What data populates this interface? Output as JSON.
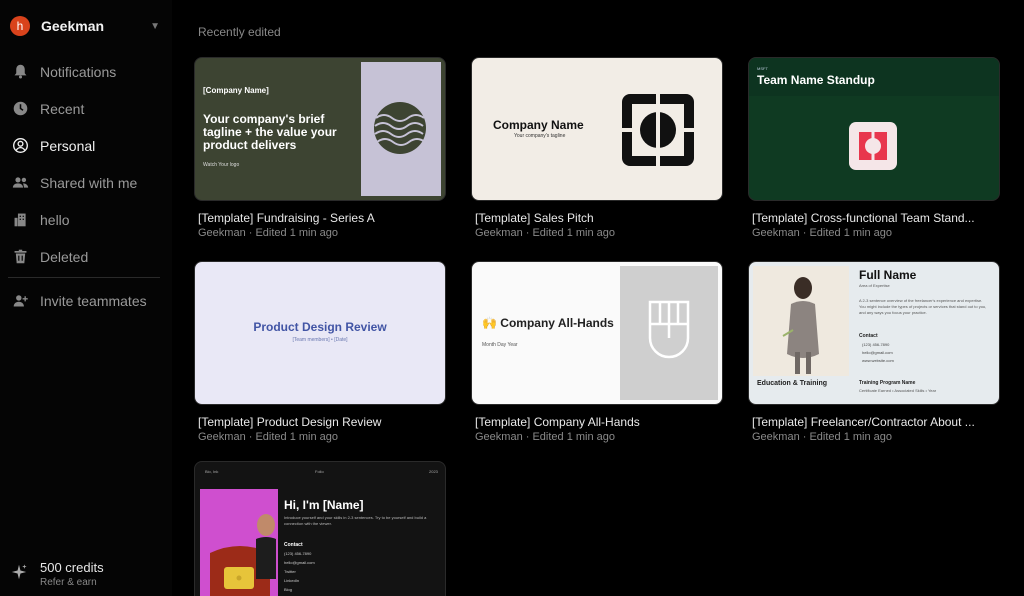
{
  "sidebar": {
    "account": {
      "initial": "h",
      "name": "Geekman"
    },
    "items": [
      {
        "label": "Notifications",
        "icon": "bell-icon"
      },
      {
        "label": "Recent",
        "icon": "clock-icon"
      },
      {
        "label": "Personal",
        "icon": "user-circle-icon",
        "active": true
      },
      {
        "label": "Shared with me",
        "icon": "users-icon"
      },
      {
        "label": "hello",
        "icon": "building-icon"
      },
      {
        "label": "Deleted",
        "icon": "trash-icon"
      }
    ],
    "invite": {
      "label": "Invite teammates",
      "icon": "user-plus-icon"
    },
    "credits": {
      "amount": "500 credits",
      "subtitle": "Refer & earn",
      "icon": "sparkle-icon"
    }
  },
  "main": {
    "section_title": "Recently edited",
    "cards": [
      {
        "title": "[Template] Fundraising - Series A",
        "meta": "Geekman · Edited 1 min ago",
        "thumb": {
          "company": "[Company Name]",
          "tagline": "Your company's brief tagline + the value your product delivers",
          "logo_text": "Watch Your logo"
        }
      },
      {
        "title": "[Template] Sales Pitch",
        "meta": "Geekman · Edited 1 min ago",
        "thumb": {
          "company": "Company Name",
          "subtitle": "Your company's tagline"
        }
      },
      {
        "title": "[Template] Cross-functional Team Stand...",
        "meta": "Geekman · Edited 1 min ago",
        "thumb": {
          "tiny": "MSFT",
          "title": "Team Name Standup"
        }
      },
      {
        "title": "[Template] Product Design Review",
        "meta": "Geekman · Edited 1 min ago",
        "thumb": {
          "title": "Product Design Review",
          "subtitle": "[Team members] • [Date]"
        }
      },
      {
        "title": "[Template] Company All-Hands",
        "meta": "Geekman · Edited 1 min ago",
        "thumb": {
          "title": "🙌 Company All-Hands",
          "subtitle": "Month Day Year"
        }
      },
      {
        "title": "[Template] Freelancer/Contractor About ...",
        "meta": "Geekman · Edited 1 min ago",
        "thumb": {
          "name": "Full Name",
          "expertise": "Area of Expertise",
          "para": "A 2-3 sentence overview of the freelancer's experience and expertise. You might include the types of projects or services that stand out to you, and any ways you focus your practice.",
          "contact": "Contact",
          "phone": "(123) 456-7890",
          "email": "hello@gmail.com",
          "site": "www.website.com",
          "education": "Education & Training",
          "program": "Training Program Name",
          "program_sub": "Certificate Earned • Associated Skills • Year"
        }
      },
      {
        "title": "",
        "meta": "",
        "thumb": {
          "nav_left": "Bio, Ink",
          "nav_mid": "Folio",
          "nav_right": "2023",
          "title": "Hi, I'm [Name]",
          "intro": "Introduce yourself and your skills in 2-3 sentences. Try to be yourself and build a connection with the viewer.",
          "contact": "Contact",
          "phone": "(123) 456-7890",
          "email": "hello@gmail.com",
          "twitter": "Twitter",
          "linkedin": "LinkedIn",
          "blog": "Blog"
        }
      }
    ]
  }
}
